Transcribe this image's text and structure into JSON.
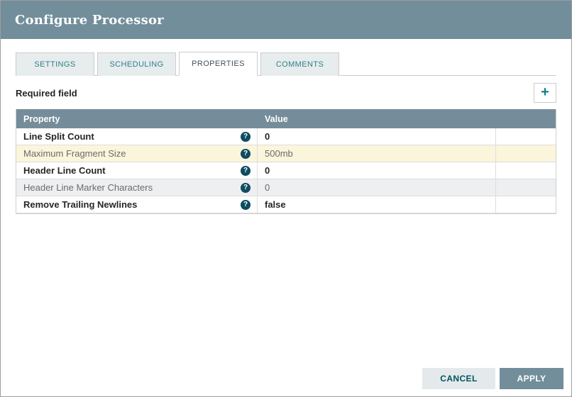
{
  "dialog": {
    "title": "Configure Processor",
    "required_field_label": "Required field"
  },
  "tabs": [
    {
      "label": "SETTINGS",
      "active": false
    },
    {
      "label": "SCHEDULING",
      "active": false
    },
    {
      "label": "PROPERTIES",
      "active": true
    },
    {
      "label": "COMMENTS",
      "active": false
    }
  ],
  "toolbar": {
    "add_icon": "plus-icon",
    "add_glyph": "+"
  },
  "properties_table": {
    "columns": [
      "Property",
      "Value"
    ],
    "help_icon_glyph": "?",
    "rows": [
      {
        "property": "Line Split Count",
        "value": "0",
        "required": true,
        "highlighted": false
      },
      {
        "property": "Maximum Fragment Size",
        "value": "500mb",
        "required": false,
        "highlighted": true
      },
      {
        "property": "Header Line Count",
        "value": "0",
        "required": true,
        "highlighted": false
      },
      {
        "property": "Header Line Marker Characters",
        "value": "0",
        "required": false,
        "highlighted": false
      },
      {
        "property": "Remove Trailing Newlines",
        "value": "false",
        "required": true,
        "highlighted": false
      }
    ]
  },
  "footer": {
    "cancel_label": "CANCEL",
    "apply_label": "APPLY"
  },
  "colors": {
    "header_bg": "#728E9B",
    "table_header_bg": "#758D9A",
    "tab_text": "#2F7F8C",
    "tab_active_text": "#44505A",
    "highlight_row_bg": "#FBF5DC",
    "alt_row_bg": "#EDEFF0",
    "help_icon_bg": "#0E4B60",
    "apply_bg": "#728E9B",
    "cancel_bg": "#E4E9EB",
    "cancel_text": "#00545E",
    "add_icon_color": "#157E8D"
  }
}
